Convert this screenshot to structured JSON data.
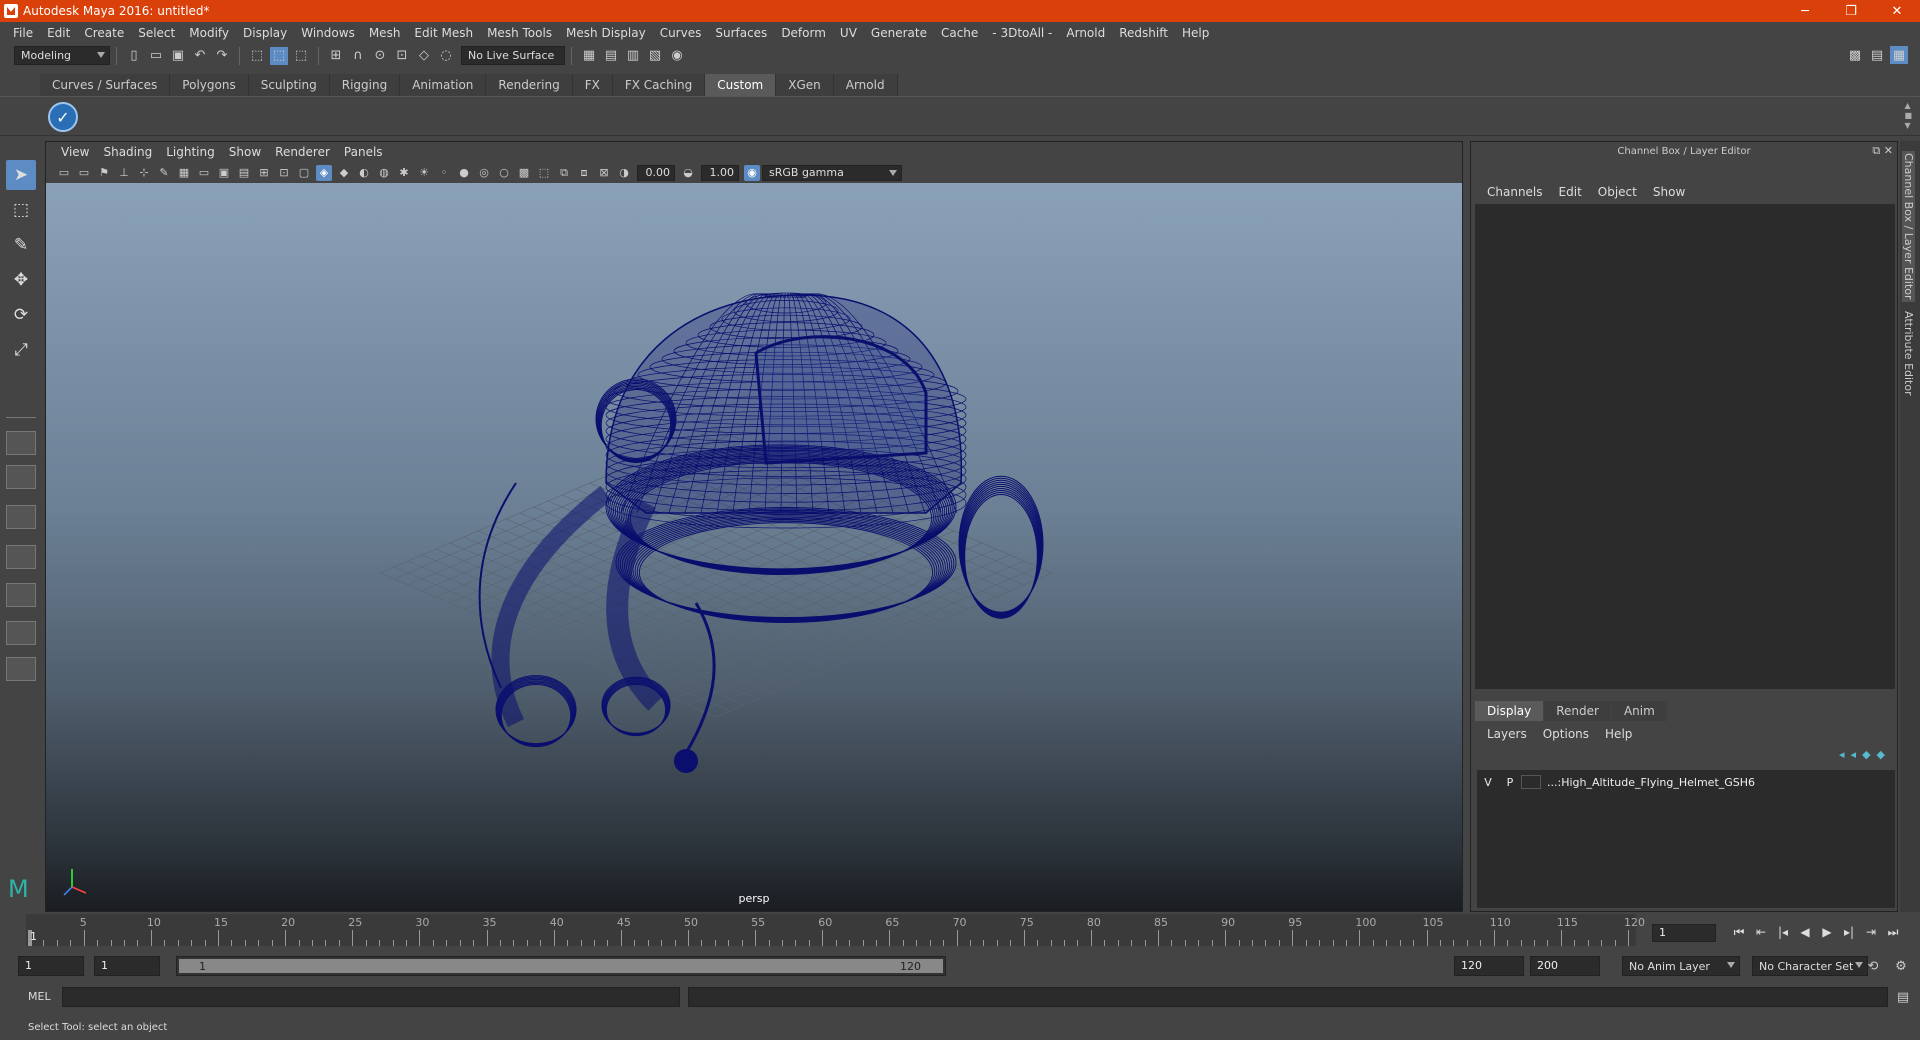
{
  "titlebar": {
    "title": "Autodesk Maya 2016: untitled*",
    "minimize": "─",
    "restore": "❐",
    "close": "✕"
  },
  "menubar": [
    "File",
    "Edit",
    "Create",
    "Select",
    "Modify",
    "Display",
    "Windows",
    "Mesh",
    "Edit Mesh",
    "Mesh Tools",
    "Mesh Display",
    "Curves",
    "Surfaces",
    "Deform",
    "UV",
    "Generate",
    "Cache",
    "- 3DtoAll -",
    "Arnold",
    "Redshift",
    "Help"
  ],
  "statusline": {
    "mode": "Modeling",
    "live_surface": "No Live Surface"
  },
  "shelf": {
    "tabs": [
      "Curves / Surfaces",
      "Polygons",
      "Sculpting",
      "Rigging",
      "Animation",
      "Rendering",
      "FX",
      "FX Caching",
      "Custom",
      "XGen",
      "Arnold"
    ],
    "active_tab": "Custom"
  },
  "viewport": {
    "menu": [
      "View",
      "Shading",
      "Lighting",
      "Show",
      "Renderer",
      "Panels"
    ],
    "exposure": "0.00",
    "gamma": "1.00",
    "colorspace": "sRGB gamma",
    "camera_label": "persp",
    "model_color": "#0a0f6e"
  },
  "channelbox": {
    "title": "Channel Box / Layer Editor",
    "menu": [
      "Channels",
      "Edit",
      "Object",
      "Show"
    ]
  },
  "layer_editor": {
    "tabs": [
      "Display",
      "Render",
      "Anim"
    ],
    "active_tab": "Display",
    "menu": [
      "Layers",
      "Options",
      "Help"
    ],
    "layers": [
      {
        "v": "V",
        "p": "P",
        "name": "...:High_Altitude_Flying_Helmet_GSH6"
      }
    ]
  },
  "side_tabs": [
    "Channel Box / Layer Editor",
    "Attribute Editor"
  ],
  "timeslider": {
    "ticks": [
      "5",
      "10",
      "15",
      "20",
      "25",
      "30",
      "35",
      "40",
      "45",
      "50",
      "55",
      "60",
      "65",
      "70",
      "75",
      "80",
      "85",
      "90",
      "95",
      "100",
      "105",
      "110",
      "115",
      "120"
    ],
    "current_frame": "1",
    "frame_field": "1"
  },
  "rangebar": {
    "start": "1",
    "playback_start": "1",
    "range_start_label": "1",
    "range_end_label": "120",
    "playback_end": "120",
    "end": "200",
    "anim_layer": "No Anim Layer",
    "character_set": "No Character Set"
  },
  "cmdline": {
    "label": "MEL"
  },
  "helpline": {
    "text": "Select Tool: select an object"
  }
}
